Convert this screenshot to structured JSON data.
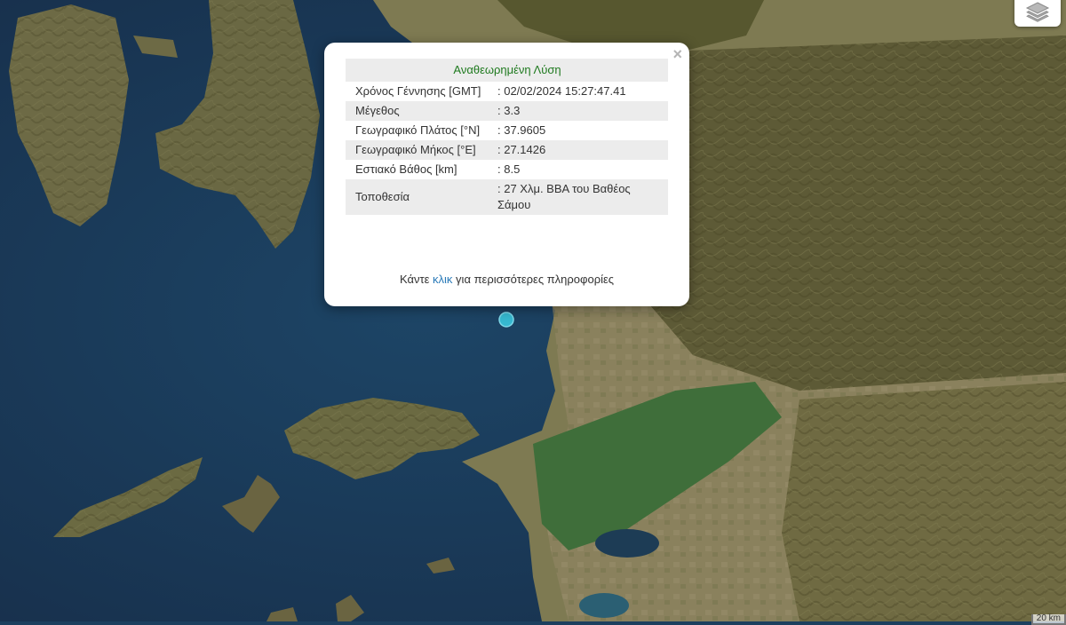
{
  "map": {
    "type": "satellite basemap",
    "marker": {
      "latitude": "37.9605",
      "longitude": "27.1426",
      "color": "#36b8d0"
    },
    "layers_icon": "layers-icon"
  },
  "popup": {
    "title": "Αναθεωρημένη Λύση",
    "close_label": "×",
    "rows": [
      {
        "label": "Χρόνος Γέννησης [GMT]",
        "value": ": 02/02/2024 15:27:47.41"
      },
      {
        "label": "Μέγεθος",
        "value": ": 3.3"
      },
      {
        "label": "Γεωγραφικό Πλάτος [°N]",
        "value": ": 37.9605"
      },
      {
        "label": "Γεωγραφικό Μήκος [°E]",
        "value": ": 27.1426"
      },
      {
        "label": "Εστιακό Βάθος [km]",
        "value": ": 8.5"
      },
      {
        "label": "Τοποθεσία",
        "value": ": 27 Χλμ. ΒΒΑ του Βαθέος Σάμου"
      }
    ],
    "footer_prefix": "Κάντε ",
    "footer_link": "κλικ",
    "footer_suffix": " για περισσότερες πληροφορίες"
  },
  "scale_label": "20 km",
  "colors": {
    "sea": "#1c3f5e",
    "title_green": "#1f7a1f",
    "link_blue": "#2a7ab8"
  }
}
